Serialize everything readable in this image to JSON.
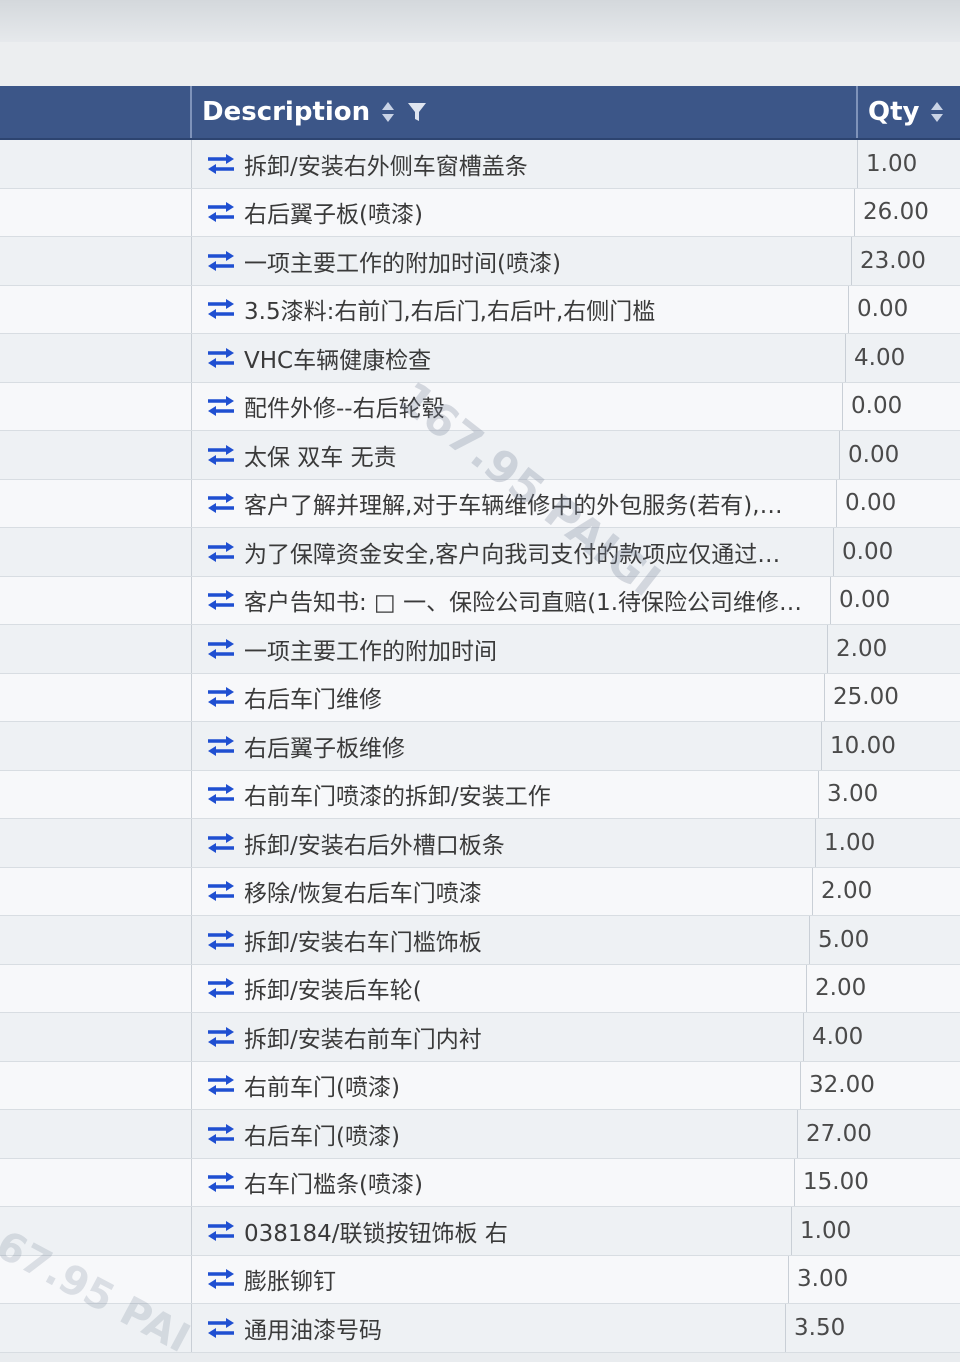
{
  "table": {
    "headers": {
      "description": "Description",
      "qty": "Qty"
    },
    "rows": [
      {
        "description": "拆卸/安装右外侧车窗槽盖条",
        "qty": "1.00"
      },
      {
        "description": "右后翼子板(喷漆)",
        "qty": "26.00"
      },
      {
        "description": "一项主要工作的附加时间(喷漆)",
        "qty": "23.00"
      },
      {
        "description": "3.5漆料:右前门,右后门,右后叶,右侧门槛",
        "qty": "0.00"
      },
      {
        "description": "VHC车辆健康检查",
        "qty": "4.00"
      },
      {
        "description": "配件外修--右后轮毂",
        "qty": "0.00"
      },
      {
        "description": "太保 双车 无责",
        "qty": "0.00"
      },
      {
        "description": "客户了解并理解,对于车辆维修中的外包服务(若有),…",
        "qty": "0.00"
      },
      {
        "description": "为了保障资金安全,客户向我司支付的款项应仅通过…",
        "qty": "0.00"
      },
      {
        "description": "客户告知书: □ 一、保险公司直赔(1.待保险公司维修…",
        "qty": "0.00"
      },
      {
        "description": "一项主要工作的附加时间",
        "qty": "2.00"
      },
      {
        "description": "右后车门维修",
        "qty": "25.00"
      },
      {
        "description": "右后翼子板维修",
        "qty": "10.00"
      },
      {
        "description": "右前车门喷漆的拆卸/安装工作",
        "qty": "3.00"
      },
      {
        "description": "拆卸/安装右后外槽口板条",
        "qty": "1.00"
      },
      {
        "description": "移除/恢复右后车门喷漆",
        "qty": "2.00"
      },
      {
        "description": "拆卸/安装右车门槛饰板",
        "qty": "5.00"
      },
      {
        "description": "拆卸/安装后车轮(",
        "qty": "2.00"
      },
      {
        "description": "拆卸/安装右前车门内衬",
        "qty": "4.00"
      },
      {
        "description": "右前车门(喷漆)",
        "qty": "32.00"
      },
      {
        "description": "右后车门(喷漆)",
        "qty": "27.00"
      },
      {
        "description": "右车门槛条(喷漆)",
        "qty": "15.00"
      },
      {
        "description": "038184/联锁按钮饰板 右",
        "qty": "1.00"
      },
      {
        "description": "膨胀铆钉",
        "qty": "3.00"
      },
      {
        "description": "通用油漆号码",
        "qty": "3.50"
      }
    ]
  },
  "watermarks": [
    "167.95 PAIGI",
    "67.95 PAI"
  ],
  "colors": {
    "header_bg": "#3c5688",
    "icon_blue": "#1f4fd1",
    "row_text": "#3a3a3a"
  },
  "icons": {
    "row": "swap-arrows-icon",
    "sort": "sort-icon",
    "filter": "filter-icon"
  }
}
